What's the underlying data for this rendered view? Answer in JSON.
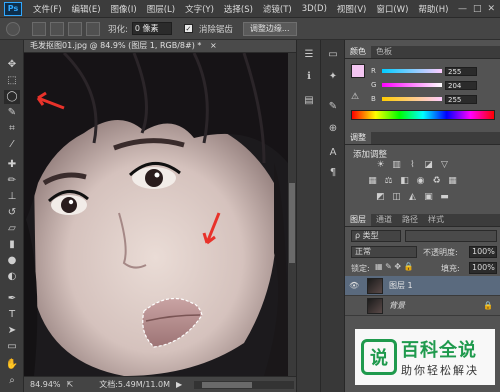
{
  "menubar": {
    "logo": "Ps",
    "items": [
      "文件(F)",
      "编辑(E)",
      "图像(I)",
      "图层(L)",
      "文字(Y)",
      "选择(S)",
      "滤镜(T)",
      "3D(D)",
      "视图(V)",
      "窗口(W)",
      "帮助(H)"
    ],
    "window_controls": [
      "—",
      "□",
      "✕"
    ]
  },
  "options": {
    "feather_label": "羽化:",
    "feather_value": "0 像素",
    "antialias_label": "消除锯齿",
    "antialias_checked": "✓",
    "refine_button": "调整边缘..."
  },
  "document": {
    "tab_title": "毛发抠图01.jpg @ 84.9% (图层 1, RGB/8#) *",
    "tab_close": "×",
    "zoom": "84.94%",
    "doc_info": "文档:5.49M/11.0M"
  },
  "color_panel": {
    "tabs": [
      "颜色",
      "色板"
    ],
    "foreground": "#f4c6f2",
    "r_label": "R",
    "g_label": "G",
    "b_label": "B",
    "r": "255",
    "g": "204",
    "b": "255",
    "r_fill": 1.0,
    "g_fill": 0.8,
    "b_fill": 1.0
  },
  "adjust_panel": {
    "tabs": [
      "调整"
    ],
    "title": "添加调整"
  },
  "layers_panel": {
    "tabs": [
      "图层",
      "通道",
      "路径",
      "样式"
    ],
    "kind_label": "ρ 类型",
    "blend_mode": "正常",
    "opacity_label": "不透明度:",
    "opacity_value": "100%",
    "lock_label": "锁定:",
    "fill_label": "填充:",
    "fill_value": "100%",
    "layers": [
      {
        "name": "图层 1",
        "visible": "👁",
        "selected": true
      },
      {
        "name": "背景",
        "visible": "",
        "selected": false
      }
    ]
  },
  "watermark": {
    "title": "百科全说",
    "subtitle": "助你轻松解决"
  },
  "colors": {
    "accent": "#31a8ff",
    "selection_arrow": "#e8322a",
    "layer_selected": "#5a6a7e"
  }
}
